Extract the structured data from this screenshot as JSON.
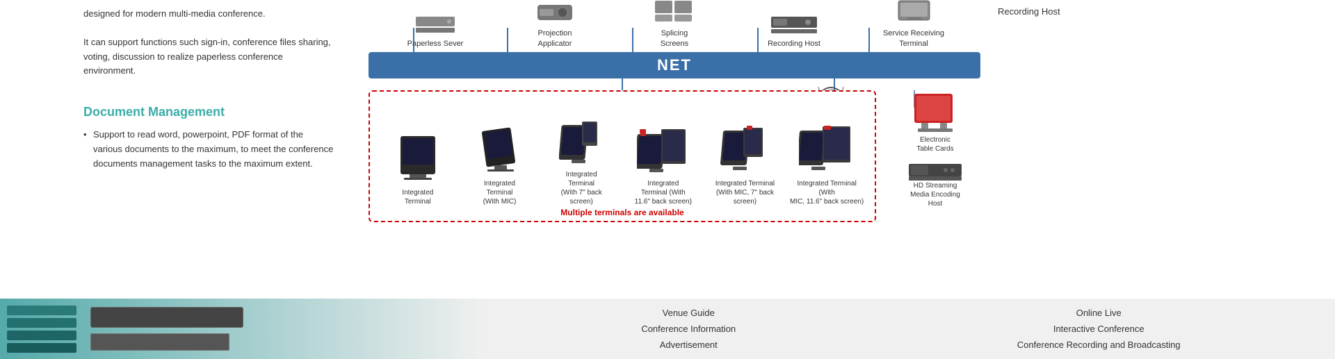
{
  "left": {
    "intro_text": "designed for modern multi-media conference.",
    "intro_text2": "It can support functions such sign-in, conference files sharing, voting, discussion to realize paperless conference environment.",
    "section_title": "Document Management",
    "bullet_point": "Support to read word, powerpoint, PDF format of the various documents to the maximum, to meet the conference documents management tasks to the maximum extent."
  },
  "diagram": {
    "net_label": "NET",
    "top_devices": [
      {
        "label": "Paperless Sever"
      },
      {
        "label": "Projection\nApplicator"
      },
      {
        "label": "Splicing\nScreens"
      },
      {
        "label": "Recording Host"
      },
      {
        "label": "Service Receiving\nTerminal"
      }
    ],
    "terminals": [
      {
        "label": "Integrated\nTerminal"
      },
      {
        "label": "Integrated\nTerminal\n(With MIC)"
      },
      {
        "label": "Integrated\nTerminal\n(With 7\" back\nscreen)"
      },
      {
        "label": "Integrated\nTerminal (With\n11.6\" back screen\n)"
      },
      {
        "label": "Integrated Terminal\n(With MIC, 7\" back\nscreen)"
      },
      {
        "label": "Integrated Terminal (With\nMIC, 11.6\" back screen)"
      }
    ],
    "multiple_label": "Multiple terminals are\navailable",
    "right_devices": [
      {
        "label": "Electronic\nTable Cards"
      },
      {
        "label": "HD Streaming\nMedia Encoding\nHost"
      }
    ]
  },
  "bottom_nav": {
    "col1": [
      "Venue Guide",
      "Conference Information",
      "Advertisement"
    ],
    "col2": [
      "Online Live",
      "Interactive Conference",
      "Conference Recording and Broadcasting"
    ]
  }
}
